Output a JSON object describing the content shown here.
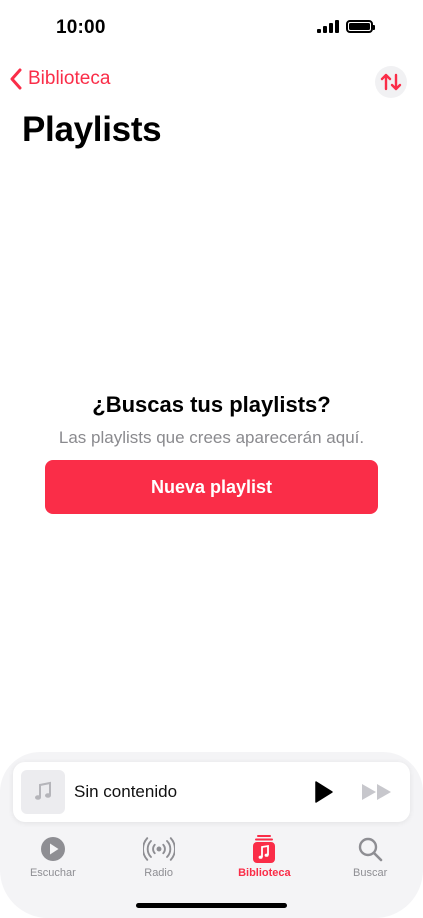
{
  "status_bar": {
    "time": "10:00"
  },
  "nav": {
    "back_label": "Biblioteca"
  },
  "page": {
    "title": "Playlists"
  },
  "empty_state": {
    "title": "¿Buscas tus playlists?",
    "subtitle": "Las playlists que crees aparecerán aquí.",
    "button_label": "Nueva playlist"
  },
  "mini_player": {
    "title": "Sin contenido"
  },
  "tabs": [
    {
      "label": "Escuchar",
      "icon": "play-circle-icon",
      "active": false
    },
    {
      "label": "Radio",
      "icon": "radio-waves-icon",
      "active": false
    },
    {
      "label": "Biblioteca",
      "icon": "library-music-icon",
      "active": true
    },
    {
      "label": "Buscar",
      "icon": "search-icon",
      "active": false
    }
  ],
  "colors": {
    "accent": "#fa2d48",
    "inactive": "#8e8e93",
    "tab_bar_bg": "#f4f4f6"
  }
}
